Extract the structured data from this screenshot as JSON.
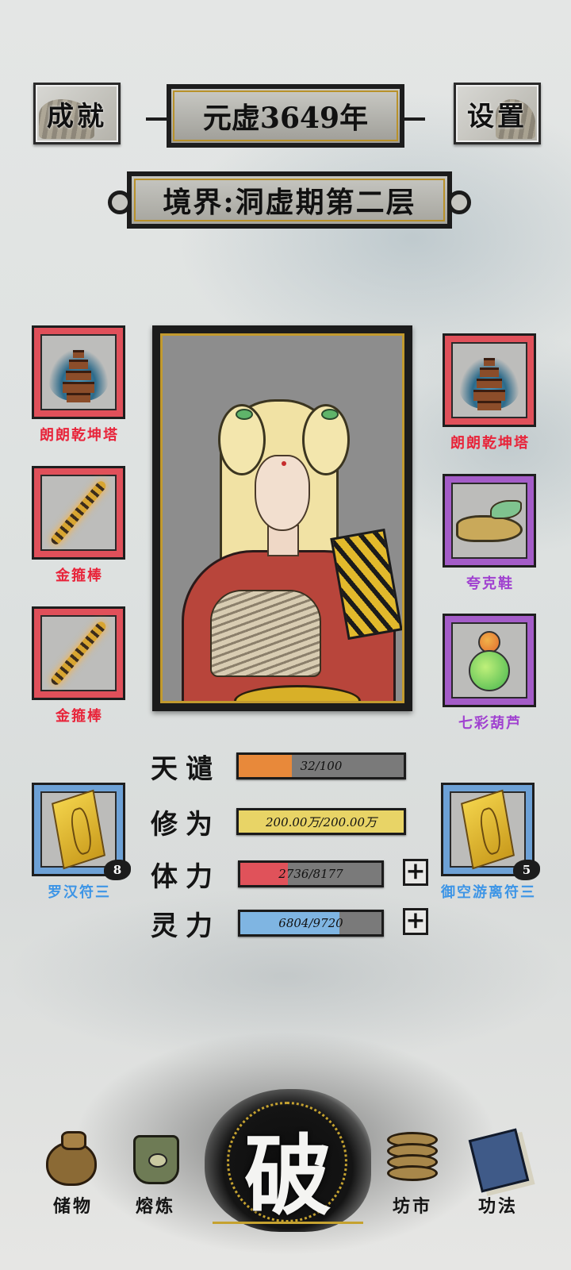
{
  "header": {
    "achievements_label": "成就",
    "settings_label": "设置",
    "year": "元虚3649年",
    "realm": "境界:洞虚期第二层"
  },
  "left_slots": [
    {
      "name": "朗朗乾坤塔",
      "rarity": "red",
      "icon": "pagoda-icon"
    },
    {
      "name": "金箍棒",
      "rarity": "red",
      "icon": "golden-rod-icon"
    },
    {
      "name": "金箍棒",
      "rarity": "red",
      "icon": "golden-rod-icon"
    },
    {
      "name": "罗汉符三",
      "rarity": "blue",
      "icon": "talisman-icon",
      "count": "8"
    }
  ],
  "right_slots": [
    {
      "name": "朗朗乾坤塔",
      "rarity": "red",
      "icon": "pagoda-icon"
    },
    {
      "name": "夸克鞋",
      "rarity": "purple",
      "icon": "shoe-icon"
    },
    {
      "name": "七彩葫芦",
      "rarity": "purple",
      "icon": "gourd-icon"
    },
    {
      "name": "御空游离符三",
      "rarity": "blue",
      "icon": "talisman-icon",
      "count": "5"
    }
  ],
  "stats": [
    {
      "label": "天谴",
      "text": "32/100",
      "fraction": 0.32,
      "color": "#e8893a"
    },
    {
      "label": "修为",
      "text": "200.00万/200.00万",
      "fraction": 1.0,
      "color": "#e8d466"
    },
    {
      "label": "体力",
      "text": "2736/8177",
      "fraction": 0.335,
      "color": "#e0525a"
    },
    {
      "label": "灵力",
      "text": "6804/9720",
      "fraction": 0.7,
      "color": "#7fb5e2"
    }
  ],
  "plus_label": "+",
  "nav": {
    "storage": "储物",
    "smelting": "熔炼",
    "breakthrough": "破",
    "market": "坊市",
    "techniques": "功法"
  },
  "colors": {
    "rarity_red": "#e0505a",
    "rarity_purple": "#a45cc8",
    "rarity_blue": "#6da1d6",
    "gold_trim": "#c29a2e"
  }
}
